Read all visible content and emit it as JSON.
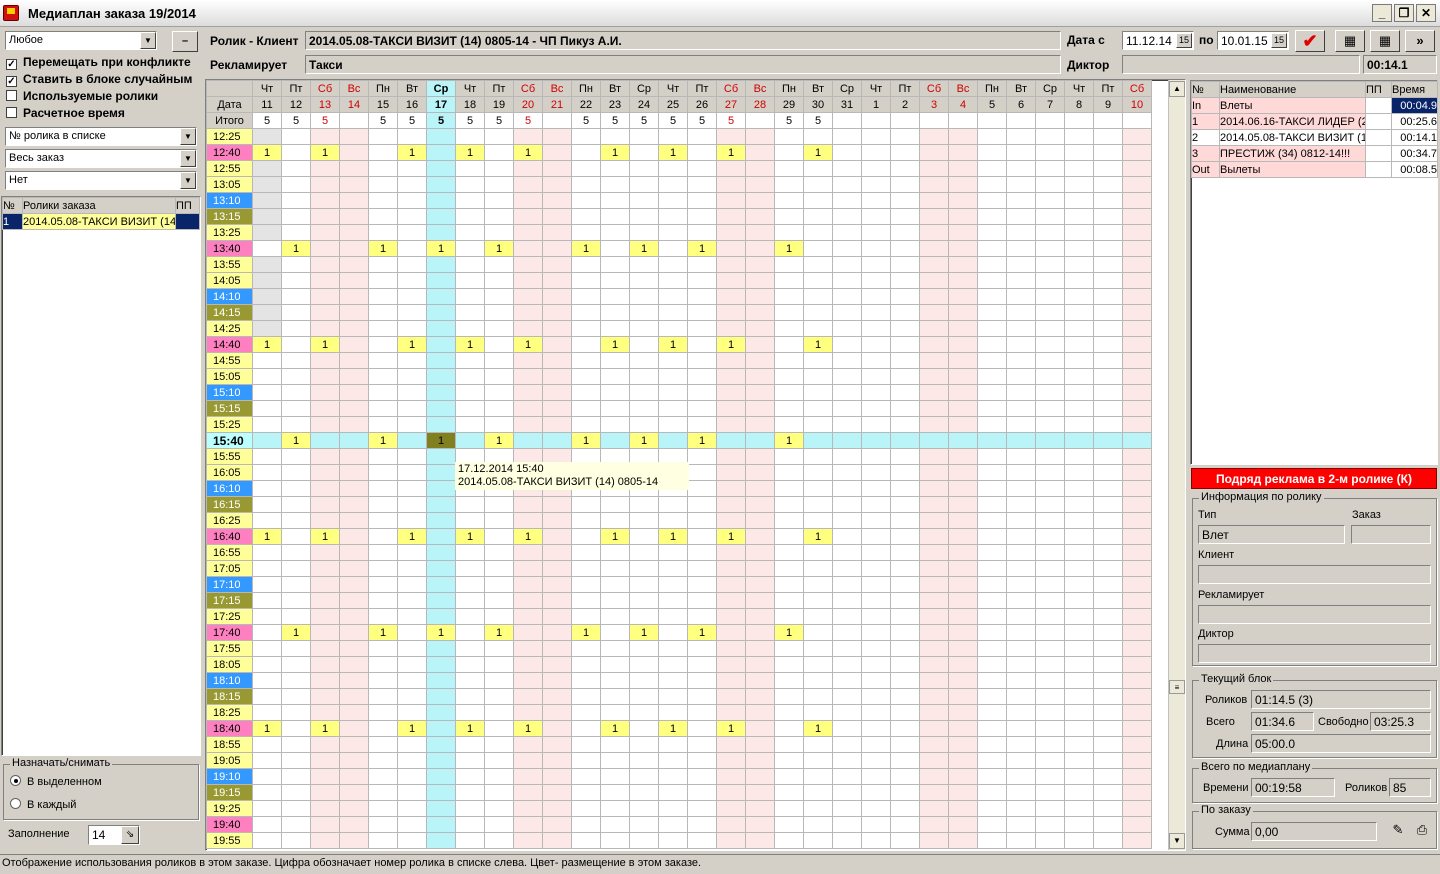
{
  "window": {
    "title": "Медиаплан заказа 19/2014"
  },
  "left": {
    "filter_combo": "Любое",
    "filter_btn": "–",
    "checks": [
      {
        "label": "Перемещать при конфликте",
        "checked": true
      },
      {
        "label": "Ставить в блоке случайным",
        "checked": true
      },
      {
        "label": "Используемые ролики",
        "checked": false
      },
      {
        "label": "Расчетное время",
        "checked": false
      }
    ],
    "combo_sort": "№ ролика в списке",
    "combo_scope": "Весь заказ",
    "combo_none": "Нет",
    "clips_table": {
      "headers": [
        "№",
        "Ролики заказа",
        "ПП"
      ],
      "rows": [
        [
          "1",
          "2014.05.08-ТАКСИ ВИЗИТ (14",
          ""
        ]
      ]
    },
    "assign": {
      "title": "Назначать/снимать",
      "options": [
        "В выделенном",
        "В каждый"
      ],
      "selected": 0
    },
    "fill": {
      "label": "Заполнение",
      "value": "14"
    }
  },
  "top": {
    "clip_client_label": "Ролик - Клиент",
    "clip_client_value": "2014.05.08-ТАКСИ ВИЗИТ (14) 0805-14 - ЧП Пикуз А.И.",
    "advertises_label": "Рекламирует",
    "advertises_value": "Такси",
    "date_from_label": "Дата с",
    "date_from": "11.12.14",
    "date_to_label": "по",
    "date_to": "10.01.15",
    "announcer_label": "Диктор",
    "announcer_value": "",
    "duration": "00:14.1",
    "cal_glyph": "15",
    "apply_glyph": "✔",
    "more_glyph": "»"
  },
  "grid": {
    "row_labels": {
      "day": "",
      "date": "Дата",
      "total": "Итого"
    },
    "days": [
      {
        "dow": "Чт",
        "date": "11",
        "total": "5",
        "we": false
      },
      {
        "dow": "Пт",
        "date": "12",
        "total": "5",
        "we": false
      },
      {
        "dow": "Сб",
        "date": "13",
        "total": "5",
        "we": true
      },
      {
        "dow": "Вс",
        "date": "14",
        "total": "",
        "we": true
      },
      {
        "dow": "Пн",
        "date": "15",
        "total": "5",
        "we": false
      },
      {
        "dow": "Вт",
        "date": "16",
        "total": "5",
        "we": false
      },
      {
        "dow": "Ср",
        "date": "17",
        "total": "5",
        "we": false,
        "today": true
      },
      {
        "dow": "Чт",
        "date": "18",
        "total": "5",
        "we": false
      },
      {
        "dow": "Пт",
        "date": "19",
        "total": "5",
        "we": false
      },
      {
        "dow": "Сб",
        "date": "20",
        "total": "5",
        "we": true
      },
      {
        "dow": "Вс",
        "date": "21",
        "total": "",
        "we": true
      },
      {
        "dow": "Пн",
        "date": "22",
        "total": "5",
        "we": false
      },
      {
        "dow": "Вт",
        "date": "23",
        "total": "5",
        "we": false
      },
      {
        "dow": "Ср",
        "date": "24",
        "total": "5",
        "we": false
      },
      {
        "dow": "Чт",
        "date": "25",
        "total": "5",
        "we": false
      },
      {
        "dow": "Пт",
        "date": "26",
        "total": "5",
        "we": false
      },
      {
        "dow": "Сб",
        "date": "27",
        "total": "5",
        "we": true
      },
      {
        "dow": "Вс",
        "date": "28",
        "total": "",
        "we": true
      },
      {
        "dow": "Пн",
        "date": "29",
        "total": "5",
        "we": false
      },
      {
        "dow": "Вт",
        "date": "30",
        "total": "5",
        "we": false
      },
      {
        "dow": "Ср",
        "date": "31",
        "total": "",
        "we": false
      },
      {
        "dow": "Чт",
        "date": "1",
        "total": "",
        "we": false
      },
      {
        "dow": "Пт",
        "date": "2",
        "total": "",
        "we": false
      },
      {
        "dow": "Сб",
        "date": "3",
        "total": "",
        "we": true
      },
      {
        "dow": "Вс",
        "date": "4",
        "total": "",
        "we": true
      },
      {
        "dow": "Пн",
        "date": "5",
        "total": "",
        "we": false
      },
      {
        "dow": "Вт",
        "date": "6",
        "total": "",
        "we": false
      },
      {
        "dow": "Ср",
        "date": "7",
        "total": "",
        "we": false
      },
      {
        "dow": "Чт",
        "date": "8",
        "total": "",
        "we": false
      },
      {
        "dow": "Пт",
        "date": "9",
        "total": "",
        "we": false
      },
      {
        "dow": "Сб",
        "date": "10",
        "total": "",
        "we": true
      }
    ],
    "times": [
      {
        "t": "12:25",
        "c": "y"
      },
      {
        "t": "12:40",
        "c": "p"
      },
      {
        "t": "12:55",
        "c": "y"
      },
      {
        "t": "13:05",
        "c": "y"
      },
      {
        "t": "13:10",
        "c": "b"
      },
      {
        "t": "13:15",
        "c": "o"
      },
      {
        "t": "13:25",
        "c": "y"
      },
      {
        "t": "13:40",
        "c": "p"
      },
      {
        "t": "13:55",
        "c": "y"
      },
      {
        "t": "14:05",
        "c": "y"
      },
      {
        "t": "14:10",
        "c": "b"
      },
      {
        "t": "14:15",
        "c": "o"
      },
      {
        "t": "14:25",
        "c": "y"
      },
      {
        "t": "14:40",
        "c": "p"
      },
      {
        "t": "14:55",
        "c": "y"
      },
      {
        "t": "15:05",
        "c": "y"
      },
      {
        "t": "15:10",
        "c": "b"
      },
      {
        "t": "15:15",
        "c": "o"
      },
      {
        "t": "15:25",
        "c": "y"
      },
      {
        "t": "15:40",
        "c": "sel"
      },
      {
        "t": "15:55",
        "c": "y"
      },
      {
        "t": "16:05",
        "c": "y"
      },
      {
        "t": "16:10",
        "c": "b"
      },
      {
        "t": "16:15",
        "c": "o"
      },
      {
        "t": "16:25",
        "c": "y"
      },
      {
        "t": "16:40",
        "c": "p"
      },
      {
        "t": "16:55",
        "c": "y"
      },
      {
        "t": "17:05",
        "c": "y"
      },
      {
        "t": "17:10",
        "c": "b"
      },
      {
        "t": "17:15",
        "c": "o"
      },
      {
        "t": "17:25",
        "c": "y"
      },
      {
        "t": "17:40",
        "c": "p"
      },
      {
        "t": "17:55",
        "c": "y"
      },
      {
        "t": "18:05",
        "c": "y"
      },
      {
        "t": "18:10",
        "c": "b"
      },
      {
        "t": "18:15",
        "c": "o"
      },
      {
        "t": "18:25",
        "c": "y"
      },
      {
        "t": "18:40",
        "c": "p"
      },
      {
        "t": "18:55",
        "c": "y"
      },
      {
        "t": "19:05",
        "c": "y"
      },
      {
        "t": "19:10",
        "c": "b"
      },
      {
        "t": "19:15",
        "c": "o"
      },
      {
        "t": "19:25",
        "c": "y"
      },
      {
        "t": "19:40",
        "c": "p"
      },
      {
        "t": "19:55",
        "c": "y"
      }
    ],
    "mark_value": "1",
    "patternA": [
      0,
      2,
      5,
      7,
      9,
      12,
      14,
      16,
      19
    ],
    "patternB": [
      1,
      4,
      6,
      8,
      11,
      13,
      15,
      18
    ],
    "rowsA": [
      "12:40",
      "14:40",
      "16:40",
      "18:40"
    ],
    "rowsB": [
      "13:40",
      "15:40",
      "17:40"
    ],
    "selected_row": "15:40",
    "selected_col": 6,
    "tooltip": [
      "17.12.2014 15:40",
      "2014.05.08-ТАКСИ ВИЗИТ (14) 0805-14"
    ]
  },
  "right": {
    "blocks_table": {
      "headers": [
        "№",
        "Наименование",
        "ПП",
        "Время"
      ],
      "rows": [
        {
          "n": "In",
          "name": "Влеты",
          "pp": "",
          "time": "00:04.9",
          "pink": true,
          "timesel": true
        },
        {
          "n": "1",
          "name": "2014.06.16-ТАКСИ ЛИДЕР (2",
          "pp": "",
          "time": "00:25.6",
          "pink": true
        },
        {
          "n": "2",
          "name": "2014.05.08-ТАКСИ ВИЗИТ (1",
          "pp": "",
          "time": "00:14.1",
          "pink": false
        },
        {
          "n": "3",
          "name": "ПРЕСТИЖ (34) 0812-14!!!",
          "pp": "",
          "time": "00:34.7",
          "pink": true
        },
        {
          "n": "Out",
          "name": "Вылеты",
          "pp": "",
          "time": "00:08.5",
          "pink": true
        }
      ]
    },
    "red_button": "Подряд реклама в 2-м ролике (К)",
    "info": {
      "title": "Информация по ролику",
      "type_label": "Тип",
      "type_value": "Влет",
      "order_label": "Заказ",
      "order_value": "",
      "client_label": "Клиент",
      "client_value": "",
      "adv_label": "Рекламирует",
      "adv_value": "",
      "announcer_label": "Диктор",
      "announcer_value": ""
    },
    "block": {
      "title": "Текущий блок",
      "clips_label": "Роликов",
      "clips_value": "01:14.5 (3)",
      "total_label": "Всего",
      "total_value": "01:34.6",
      "free_label": "Свободно",
      "free_value": "03:25.3",
      "len_label": "Длина",
      "len_value": "05:00.0"
    },
    "plan": {
      "title": "Всего по медиаплану",
      "time_label": "Времени",
      "time_value": "00:19:58",
      "count_label": "Роликов",
      "count_value": "85"
    },
    "order": {
      "title": "По заказу",
      "sum_label": "Сумма",
      "sum_value": "0,00"
    }
  },
  "status": "Отображение использования роликов в этом заказе. Цифра обозначает номер ролика в списке слева. Цвет- размещение в этом заказе.",
  "colors": {
    "weekend_text": "#d00000",
    "today": "#b8f4f8",
    "mark": "#ffff80",
    "red": "#ff0000"
  }
}
